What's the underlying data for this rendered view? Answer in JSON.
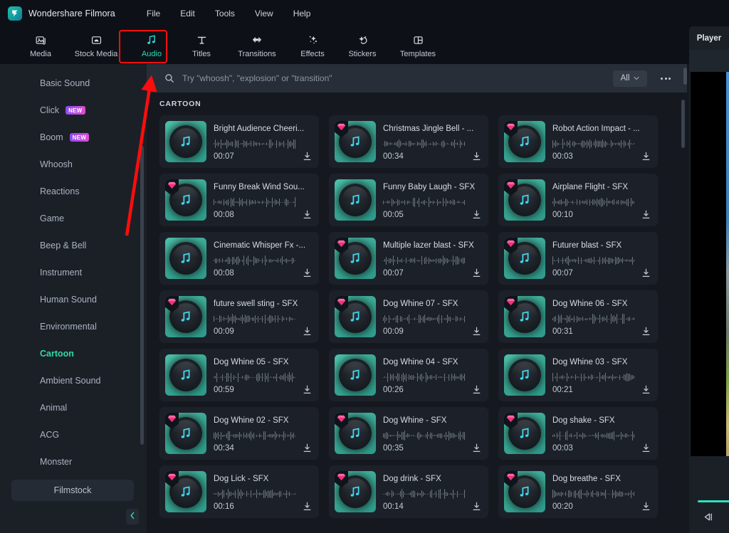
{
  "app": {
    "title": "Wondershare Filmora",
    "logo_icon": "filmora-logo-icon"
  },
  "menubar": {
    "items": [
      {
        "label": "File"
      },
      {
        "label": "Edit"
      },
      {
        "label": "Tools"
      },
      {
        "label": "View"
      },
      {
        "label": "Help"
      }
    ]
  },
  "toolbar": {
    "tabs": [
      {
        "label": "Media",
        "icon": "media-icon",
        "active": false
      },
      {
        "label": "Stock Media",
        "icon": "stock-media-icon",
        "active": false
      },
      {
        "label": "Audio",
        "icon": "audio-note-icon",
        "active": true
      },
      {
        "label": "Titles",
        "icon": "titles-t-icon",
        "active": false
      },
      {
        "label": "Transitions",
        "icon": "transitions-icon",
        "active": false
      },
      {
        "label": "Effects",
        "icon": "effects-wand-icon",
        "active": false
      },
      {
        "label": "Stickers",
        "icon": "stickers-icon",
        "active": false
      },
      {
        "label": "Templates",
        "icon": "templates-icon",
        "active": false
      }
    ]
  },
  "sidebar": {
    "items": [
      {
        "label": "Basic Sound",
        "badge": null,
        "selected": false
      },
      {
        "label": "Click",
        "badge": "NEW",
        "selected": false
      },
      {
        "label": "Boom",
        "badge": "NEW",
        "selected": false
      },
      {
        "label": "Whoosh",
        "badge": null,
        "selected": false
      },
      {
        "label": "Reactions",
        "badge": null,
        "selected": false
      },
      {
        "label": "Game",
        "badge": null,
        "selected": false
      },
      {
        "label": "Beep & Bell",
        "badge": null,
        "selected": false
      },
      {
        "label": "Instrument",
        "badge": null,
        "selected": false
      },
      {
        "label": "Human Sound",
        "badge": null,
        "selected": false
      },
      {
        "label": "Environmental",
        "badge": null,
        "selected": false
      },
      {
        "label": "Cartoon",
        "badge": null,
        "selected": true
      },
      {
        "label": "Ambient Sound",
        "badge": null,
        "selected": false
      },
      {
        "label": "Animal",
        "badge": null,
        "selected": false
      },
      {
        "label": "ACG",
        "badge": null,
        "selected": false
      },
      {
        "label": "Monster",
        "badge": null,
        "selected": false
      }
    ],
    "filmstock_label": "Filmstock",
    "collapse_icon": "chevron-left-icon"
  },
  "search": {
    "icon": "search-icon",
    "placeholder": "Try \"whoosh\", \"explosion\" or \"transition\"",
    "value": "",
    "filter_label": "All",
    "filter_icon": "chevron-down-icon",
    "more_icon": "more-dots-icon"
  },
  "main": {
    "section_title": "CARTOON",
    "cards": [
      {
        "title": "Bright Audience Cheeri...",
        "duration": "00:07",
        "premium": false,
        "download_icon": "download-icon"
      },
      {
        "title": "Christmas Jingle Bell - ...",
        "duration": "00:34",
        "premium": true,
        "download_icon": "download-icon"
      },
      {
        "title": "Robot Action Impact - ...",
        "duration": "00:03",
        "premium": true,
        "download_icon": "download-icon"
      },
      {
        "title": "Funny Break Wind Sou...",
        "duration": "00:08",
        "premium": true,
        "download_icon": "download-icon"
      },
      {
        "title": "Funny Baby Laugh - SFX",
        "duration": "00:05",
        "premium": false,
        "download_icon": "download-icon"
      },
      {
        "title": "Airplane Flight - SFX",
        "duration": "00:10",
        "premium": true,
        "download_icon": "download-icon"
      },
      {
        "title": "Cinematic Whisper Fx -...",
        "duration": "00:08",
        "premium": false,
        "download_icon": "download-icon"
      },
      {
        "title": "Multiple lazer blast - SFX",
        "duration": "00:07",
        "premium": true,
        "download_icon": "download-icon"
      },
      {
        "title": "Futurer blast - SFX",
        "duration": "00:07",
        "premium": true,
        "download_icon": "download-icon"
      },
      {
        "title": "future swell sting - SFX",
        "duration": "00:09",
        "premium": true,
        "download_icon": "download-icon"
      },
      {
        "title": "Dog Whine 07 - SFX",
        "duration": "00:09",
        "premium": true,
        "download_icon": "download-icon"
      },
      {
        "title": "Dog Whine 06 - SFX",
        "duration": "00:31",
        "premium": true,
        "download_icon": "download-icon"
      },
      {
        "title": "Dog Whine 05 - SFX",
        "duration": "00:59",
        "premium": false,
        "download_icon": "download-icon"
      },
      {
        "title": "Dog Whine 04 - SFX",
        "duration": "00:26",
        "premium": false,
        "download_icon": "download-icon"
      },
      {
        "title": "Dog Whine 03 - SFX",
        "duration": "00:21",
        "premium": false,
        "download_icon": "download-icon"
      },
      {
        "title": "Dog Whine 02 - SFX",
        "duration": "00:34",
        "premium": true,
        "download_icon": "download-icon"
      },
      {
        "title": "Dog Whine - SFX",
        "duration": "00:35",
        "premium": true,
        "download_icon": "download-icon"
      },
      {
        "title": "Dog shake - SFX",
        "duration": "00:03",
        "premium": true,
        "download_icon": "download-icon"
      },
      {
        "title": "Dog Lick - SFX",
        "duration": "00:16",
        "premium": true,
        "download_icon": "download-icon"
      },
      {
        "title": "Dog drink - SFX",
        "duration": "00:14",
        "premium": true,
        "download_icon": "download-icon"
      },
      {
        "title": "Dog breathe - SFX",
        "duration": "00:20",
        "premium": true,
        "download_icon": "download-icon"
      }
    ]
  },
  "player": {
    "tab_label": "Player",
    "playback_icon": "step-backward-icon"
  },
  "annotation": {
    "highlight_target": "Audio",
    "arrow_color": "#fc0d0d"
  },
  "colors": {
    "accent_green": "#2fd9a8",
    "thumb_teal": "#3aa894",
    "premium_pink": "#f0337f",
    "annotation_red": "#fc0d0d",
    "panel_bg": "#1b2027",
    "content_bg": "#15191f"
  }
}
